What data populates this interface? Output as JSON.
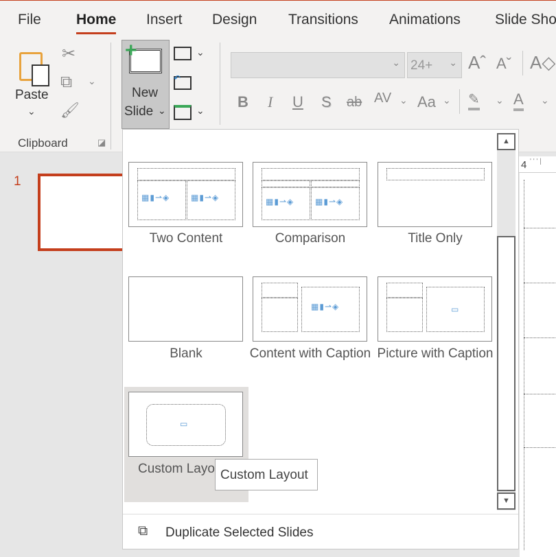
{
  "tabs": [
    {
      "label": "File"
    },
    {
      "label": "Home",
      "active": true
    },
    {
      "label": "Insert"
    },
    {
      "label": "Design"
    },
    {
      "label": "Transitions"
    },
    {
      "label": "Animations"
    },
    {
      "label": "Slide Sho"
    }
  ],
  "clipboard": {
    "paste": "Paste",
    "group": "Clipboard"
  },
  "slides": {
    "new_slide_line1": "New",
    "new_slide_line2": "Slide"
  },
  "font": {
    "name": "",
    "size": "24+"
  },
  "format": {
    "bold": "B",
    "italic": "I",
    "underline": "U",
    "shadow": "S",
    "strike": "ab",
    "spacing": "AV",
    "case": "Aa",
    "font_color": "A"
  },
  "gallery": {
    "items": [
      {
        "label": "Two Content"
      },
      {
        "label": "Comparison"
      },
      {
        "label": "Title Only"
      },
      {
        "label": "Blank"
      },
      {
        "label": "Content with Caption"
      },
      {
        "label": "Picture with Caption"
      },
      {
        "label": "Custom Layout",
        "selected": true
      }
    ]
  },
  "tooltip": "Custom Layout",
  "menu": {
    "duplicate": "Duplicate Selected Slides"
  },
  "thumbnails": {
    "number": "1"
  },
  "ruler": {
    "mark": "4"
  },
  "colors": {
    "accent": "#c43e1c",
    "ribbon": "#f3f2f1",
    "new_slide_plus": "#3aa757"
  }
}
